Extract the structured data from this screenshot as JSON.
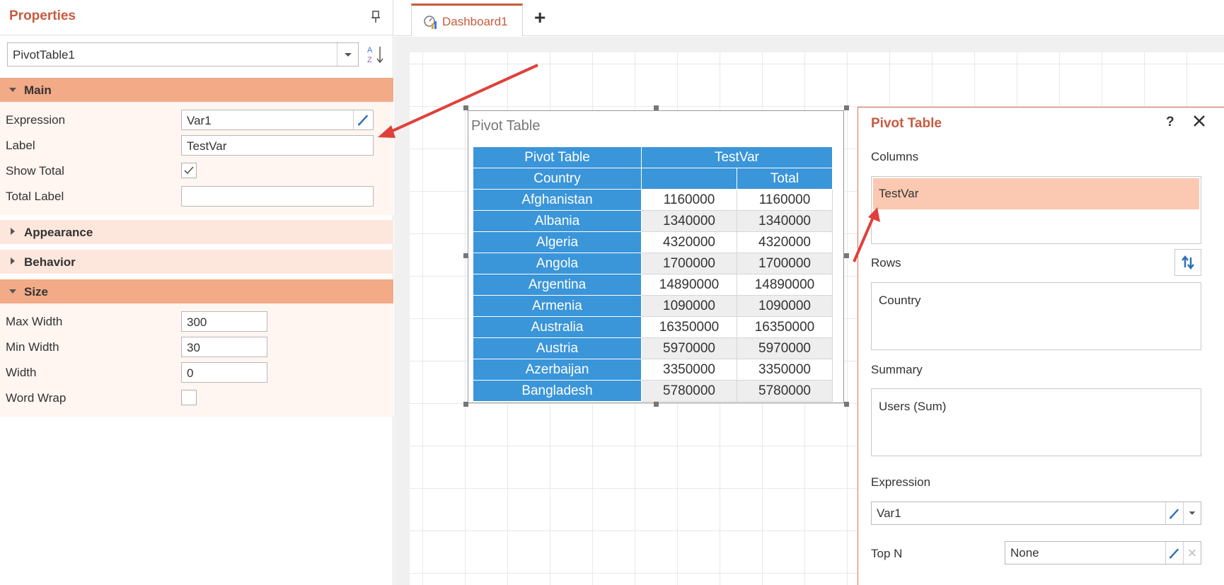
{
  "properties": {
    "title": "Properties",
    "selected_component": "PivotTable1",
    "sections": {
      "main": "Main",
      "appearance": "Appearance",
      "behavior": "Behavior",
      "size": "Size"
    },
    "main": {
      "expression_label": "Expression",
      "expression_value": "Var1",
      "label_label": "Label",
      "label_value": "TestVar",
      "show_total_label": "Show Total",
      "show_total_checked": true,
      "total_label_label": "Total Label",
      "total_label_value": ""
    },
    "size": {
      "max_width_label": "Max Width",
      "max_width_value": "300",
      "min_width_label": "Min Width",
      "min_width_value": "30",
      "width_label": "Width",
      "width_value": "0",
      "word_wrap_label": "Word Wrap",
      "word_wrap_checked": false
    }
  },
  "tabs": {
    "active": "Dashboard1",
    "add_icon": "plus-icon"
  },
  "widget": {
    "title": "Pivot Table",
    "header1": [
      "Pivot Table",
      "TestVar"
    ],
    "header2": [
      "Country",
      "",
      "Total"
    ],
    "rows": [
      [
        "Afghanistan",
        "1160000",
        "1160000"
      ],
      [
        "Albania",
        "1340000",
        "1340000"
      ],
      [
        "Algeria",
        "4320000",
        "4320000"
      ],
      [
        "Angola",
        "1700000",
        "1700000"
      ],
      [
        "Argentina",
        "14890000",
        "14890000"
      ],
      [
        "Armenia",
        "1090000",
        "1090000"
      ],
      [
        "Australia",
        "16350000",
        "16350000"
      ],
      [
        "Austria",
        "5970000",
        "5970000"
      ],
      [
        "Azerbaijan",
        "3350000",
        "3350000"
      ],
      [
        "Bangladesh",
        "5780000",
        "5780000"
      ]
    ]
  },
  "pivot_panel": {
    "title": "Pivot Table",
    "help": "?",
    "columns_label": "Columns",
    "columns_items": [
      "TestVar"
    ],
    "rows_label": "Rows",
    "rows_items": [
      "Country"
    ],
    "summary_label": "Summary",
    "summary_items": [
      "Users (Sum)"
    ],
    "expression_label": "Expression",
    "expression_value": "Var1",
    "topn_label": "Top N",
    "topn_value": "None"
  },
  "colors": {
    "accent": "#c75b3f",
    "section_open": "#f2aa87",
    "section_closed": "#fde6dc",
    "table_header": "#3a95d9",
    "column_item": "#fbc8b1",
    "arrow": "#e0403a"
  }
}
